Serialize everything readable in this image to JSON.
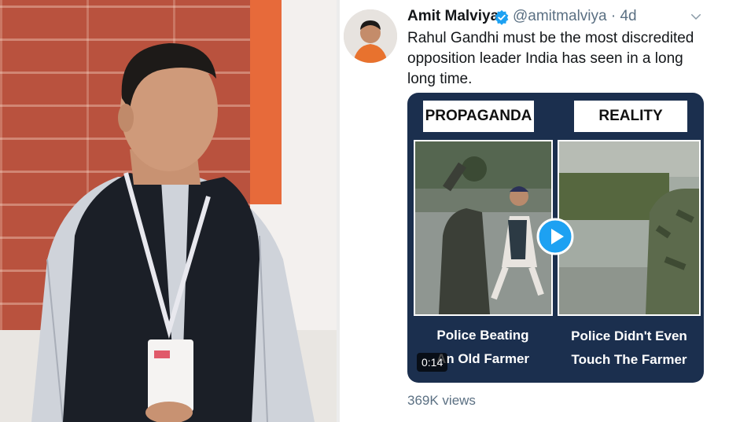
{
  "tweet": {
    "author_name": "Amit Malviya",
    "handle": "@amitmalviya",
    "separator": "·",
    "age": "4d",
    "text": "Rahul Gandhi must be the most discredited opposition leader India has seen in a long long time.",
    "views": "369K views",
    "verified_color": "#1da1f2"
  },
  "media": {
    "left_tag": "PROPAGANDA",
    "right_tag": "REALITY",
    "left_caption_line1": "Police Beating",
    "left_caption_line2": "An Old Farmer",
    "right_caption_line1": "Police Didn't Even",
    "right_caption_line2": "Touch The Farmer",
    "duration": "0:14",
    "background_color": "#1b2f4e"
  },
  "icons": {
    "verified": "verified-badge-icon",
    "menu": "chevron-down-icon",
    "play": "play-icon"
  }
}
